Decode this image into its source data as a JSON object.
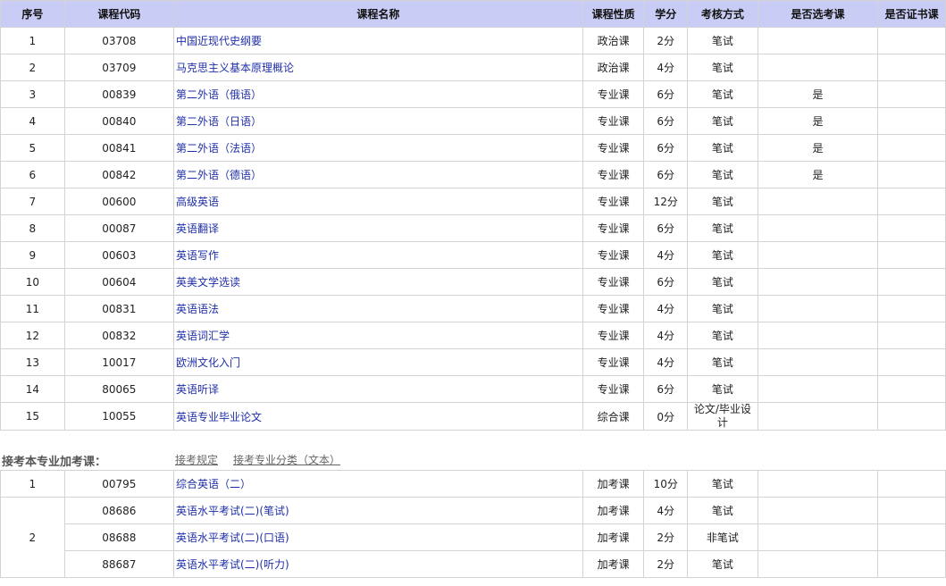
{
  "headers": [
    "序号",
    "课程代码",
    "课程名称",
    "课程性质",
    "学分",
    "考核方式",
    "是否选考课",
    "是否证书课"
  ],
  "courses": [
    {
      "no": "1",
      "code": "03708",
      "name": "中国近现代史纲要",
      "type": "政治课",
      "credit": "2分",
      "exam": "笔试",
      "elective": "",
      "cert": ""
    },
    {
      "no": "2",
      "code": "03709",
      "name": "马克思主义基本原理概论",
      "type": "政治课",
      "credit": "4分",
      "exam": "笔试",
      "elective": "",
      "cert": ""
    },
    {
      "no": "3",
      "code": "00839",
      "name": "第二外语（俄语）",
      "type": "专业课",
      "credit": "6分",
      "exam": "笔试",
      "elective": "是",
      "cert": ""
    },
    {
      "no": "4",
      "code": "00840",
      "name": "第二外语（日语）",
      "type": "专业课",
      "credit": "6分",
      "exam": "笔试",
      "elective": "是",
      "cert": ""
    },
    {
      "no": "5",
      "code": "00841",
      "name": "第二外语（法语）",
      "type": "专业课",
      "credit": "6分",
      "exam": "笔试",
      "elective": "是",
      "cert": ""
    },
    {
      "no": "6",
      "code": "00842",
      "name": "第二外语（德语）",
      "type": "专业课",
      "credit": "6分",
      "exam": "笔试",
      "elective": "是",
      "cert": ""
    },
    {
      "no": "7",
      "code": "00600",
      "name": "高级英语",
      "type": "专业课",
      "credit": "12分",
      "exam": "笔试",
      "elective": "",
      "cert": ""
    },
    {
      "no": "8",
      "code": "00087",
      "name": "英语翻译",
      "type": "专业课",
      "credit": "6分",
      "exam": "笔试",
      "elective": "",
      "cert": ""
    },
    {
      "no": "9",
      "code": "00603",
      "name": "英语写作",
      "type": "专业课",
      "credit": "4分",
      "exam": "笔试",
      "elective": "",
      "cert": ""
    },
    {
      "no": "10",
      "code": "00604",
      "name": "英美文学选读",
      "type": "专业课",
      "credit": "6分",
      "exam": "笔试",
      "elective": "",
      "cert": ""
    },
    {
      "no": "11",
      "code": "00831",
      "name": "英语语法",
      "type": "专业课",
      "credit": "4分",
      "exam": "笔试",
      "elective": "",
      "cert": ""
    },
    {
      "no": "12",
      "code": "00832",
      "name": "英语词汇学",
      "type": "专业课",
      "credit": "4分",
      "exam": "笔试",
      "elective": "",
      "cert": ""
    },
    {
      "no": "13",
      "code": "10017",
      "name": "欧洲文化入门",
      "type": "专业课",
      "credit": "4分",
      "exam": "笔试",
      "elective": "",
      "cert": ""
    },
    {
      "no": "14",
      "code": "80065",
      "name": "英语听译",
      "type": "专业课",
      "credit": "6分",
      "exam": "笔试",
      "elective": "",
      "cert": ""
    },
    {
      "no": "15",
      "code": "10055",
      "name": "英语专业毕业论文",
      "type": "综合课",
      "credit": "0分",
      "exam": "论文/毕业设计",
      "elective": "",
      "cert": ""
    }
  ],
  "extra_section": {
    "title": "接考本专业加考课：",
    "link1": "接考规定",
    "link2": "接考专业分类（文本）",
    "rows": [
      {
        "no": "1",
        "code": "00795",
        "name": "综合英语（二）",
        "type": "加考课",
        "credit": "10分",
        "exam": "笔试"
      },
      {
        "no": "2",
        "code": "08686",
        "name": "英语水平考试(二)(笔试)",
        "type": "加考课",
        "credit": "4分",
        "exam": "笔试"
      },
      {
        "no": "",
        "code": "08688",
        "name": "英语水平考试(二)(口语)",
        "type": "加考课",
        "credit": "2分",
        "exam": "非笔试"
      },
      {
        "no": "",
        "code": "88687",
        "name": "英语水平考试(二)(听力)",
        "type": "加考课",
        "credit": "2分",
        "exam": "笔试"
      }
    ]
  }
}
